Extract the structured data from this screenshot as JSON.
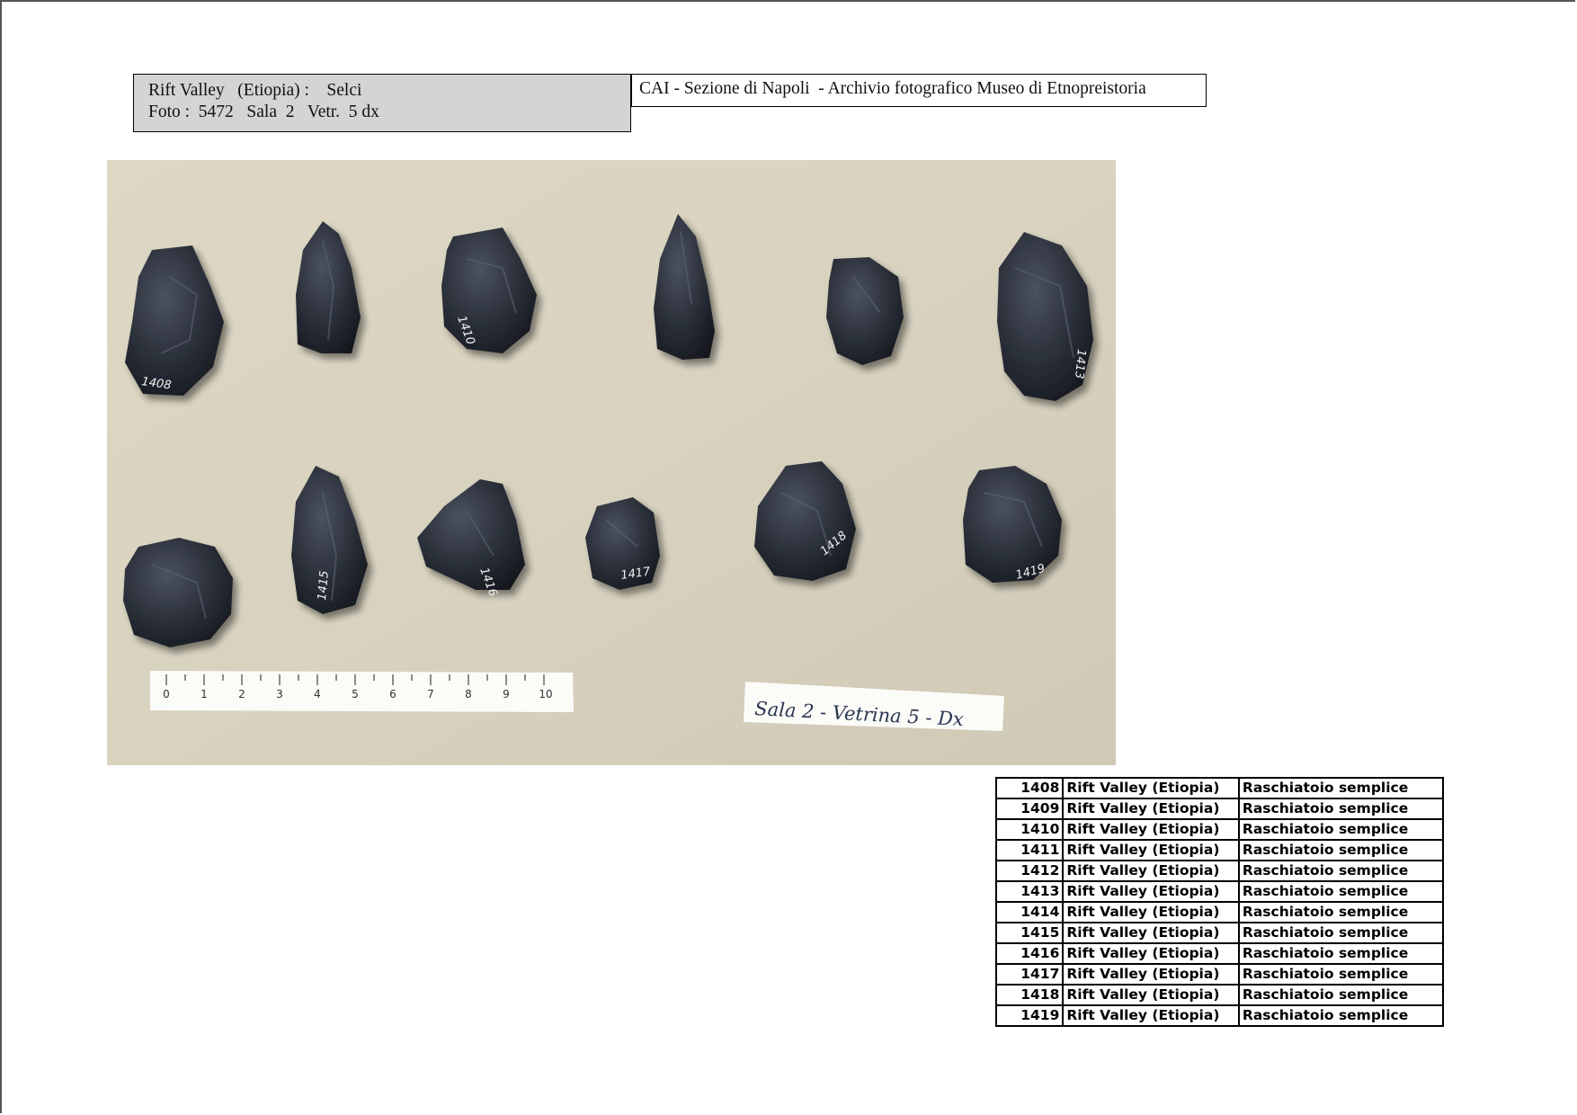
{
  "header": {
    "line1": "Rift Valley   (Etiopia) :    Selci",
    "line2": "Foto :  5472   Sala  2   Vetr.  5 dx",
    "archive": "CAI - Sezione di Napoli  - Archivio fotografico Museo di Etnopreistoria"
  },
  "photo": {
    "specimen_labels": [
      "1408",
      "1410",
      "1413",
      "1415",
      "1416",
      "1417",
      "1418",
      "1419"
    ],
    "ruler_ticks": [
      "0",
      "1",
      "2",
      "3",
      "4",
      "5",
      "6",
      "7",
      "8",
      "9",
      "10"
    ],
    "card_text": "Sala 2 - Vetrina 5 - Dx"
  },
  "catalog": {
    "rows": [
      {
        "num": "1408",
        "location": "Rift Valley (Etiopia)",
        "type": "Raschiatoio semplice"
      },
      {
        "num": "1409",
        "location": "Rift Valley (Etiopia)",
        "type": "Raschiatoio semplice"
      },
      {
        "num": "1410",
        "location": "Rift Valley (Etiopia)",
        "type": "Raschiatoio semplice"
      },
      {
        "num": "1411",
        "location": "Rift Valley (Etiopia)",
        "type": "Raschiatoio semplice"
      },
      {
        "num": "1412",
        "location": "Rift Valley (Etiopia)",
        "type": "Raschiatoio semplice"
      },
      {
        "num": "1413",
        "location": "Rift Valley (Etiopia)",
        "type": "Raschiatoio semplice"
      },
      {
        "num": "1414",
        "location": "Rift Valley (Etiopia)",
        "type": "Raschiatoio semplice"
      },
      {
        "num": "1415",
        "location": "Rift Valley (Etiopia)",
        "type": "Raschiatoio semplice"
      },
      {
        "num": "1416",
        "location": "Rift Valley (Etiopia)",
        "type": "Raschiatoio semplice"
      },
      {
        "num": "1417",
        "location": "Rift Valley (Etiopia)",
        "type": "Raschiatoio semplice"
      },
      {
        "num": "1418",
        "location": "Rift Valley (Etiopia)",
        "type": "Raschiatoio semplice"
      },
      {
        "num": "1419",
        "location": "Rift Valley (Etiopia)",
        "type": "Raschiatoio semplice"
      }
    ]
  }
}
